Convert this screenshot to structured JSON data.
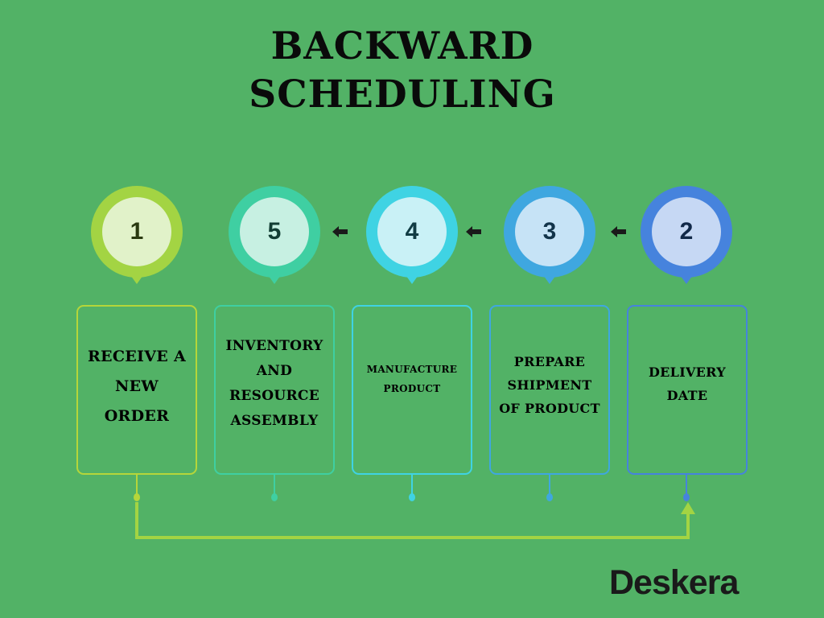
{
  "title": {
    "line1": "BACKWARD",
    "line2": "SCHEDULING"
  },
  "steps": [
    {
      "number": "1",
      "label_lines": [
        "RECEIVE A",
        "NEW",
        "ORDER"
      ],
      "ring": "#a3d443",
      "fill": "#e1f2c9",
      "text": "#2a3a10",
      "border": "#b5d63a"
    },
    {
      "number": "5",
      "label_lines": [
        "INVENTORY",
        "AND",
        "RESOURCE",
        "ASSEMBLY"
      ],
      "ring": "#3fcfa2",
      "fill": "#c7f0e2",
      "text": "#123d33",
      "border": "#3fcfa2"
    },
    {
      "number": "4",
      "label_lines": [
        "MANUFACTURE",
        "PRODUCT"
      ],
      "ring": "#3fd3e3",
      "fill": "#c9f1f6",
      "text": "#113c44",
      "border": "#3fd3e3"
    },
    {
      "number": "3",
      "label_lines": [
        "PREPARE",
        "SHIPMENT",
        "OF PRODUCT"
      ],
      "ring": "#3fa7e0",
      "fill": "#c6e3f6",
      "text": "#12344a",
      "border": "#3fa7e0"
    },
    {
      "number": "2",
      "label_lines": [
        "DELIVERY",
        "DATE"
      ],
      "ring": "#4683dd",
      "fill": "#c6d8f4",
      "text": "#112848",
      "border": "#4683dd"
    }
  ],
  "connector": {
    "color": "#a3d443",
    "from_step": "1",
    "to_step": "2"
  },
  "flow_arrows": {
    "direction": "left",
    "color": "#1a1a1a",
    "icon": "arrow-left-icon"
  },
  "brand": {
    "name": "Deskera"
  },
  "colors": {
    "background": "#52b266",
    "text": "#0a0a0a"
  }
}
